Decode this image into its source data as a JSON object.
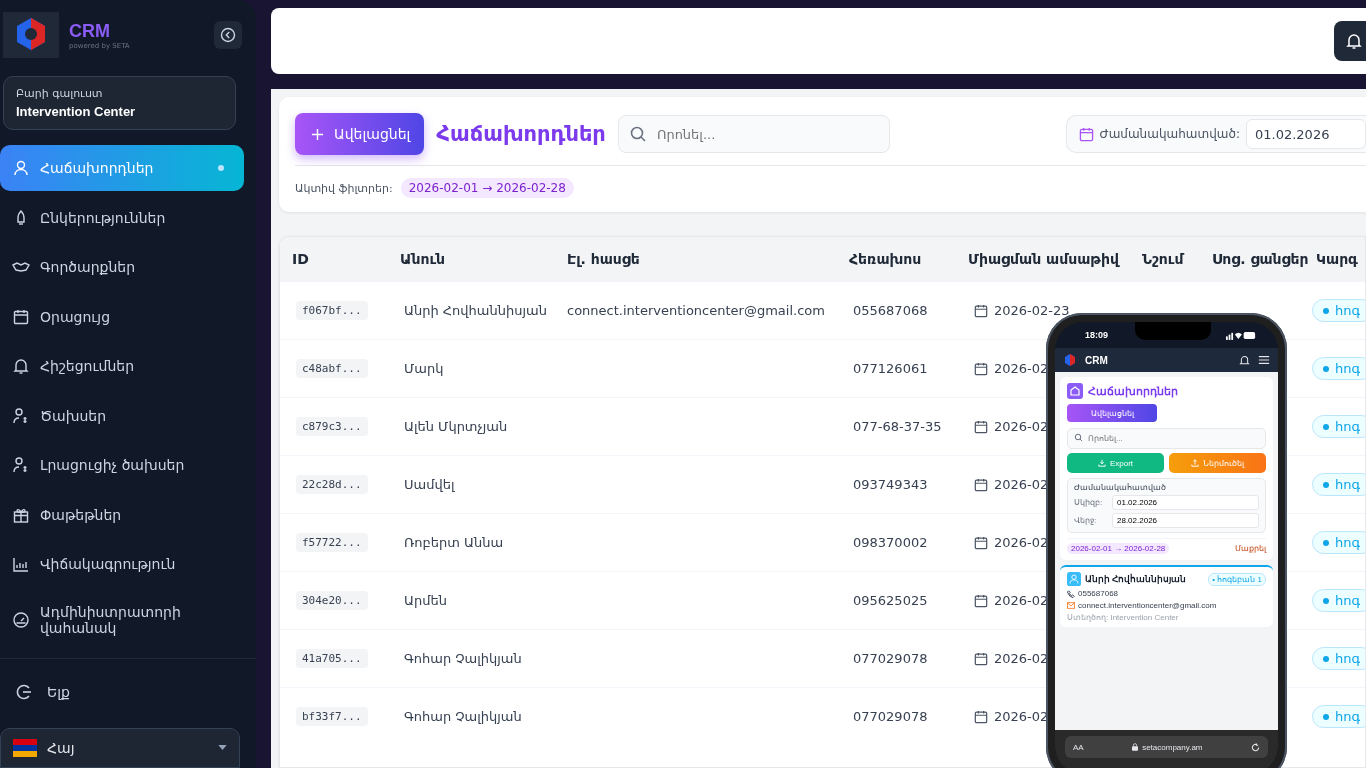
{
  "sidebar": {
    "brand": "CRM",
    "tagline": "powered by SETA",
    "welcome": {
      "greeting": "Բարի գալուստ",
      "name": "Intervention Center"
    },
    "items": [
      {
        "label": "Հաճախորդներ",
        "selected": true
      },
      {
        "label": "Ընկերություններ",
        "selected": false
      },
      {
        "label": "Գործարքներ",
        "selected": false
      },
      {
        "label": "Օրացույց",
        "selected": false
      },
      {
        "label": "Հիշեցումներ",
        "selected": false
      },
      {
        "label": "Ծախսեր",
        "selected": false
      },
      {
        "label": "Լրացուցիչ ծախսեր",
        "selected": false
      },
      {
        "label": "Փաթեթներ",
        "selected": false
      },
      {
        "label": "Վիճակագրություն",
        "selected": false
      },
      {
        "label": "Ադմինիստրատորի վահանակ",
        "selected": false
      }
    ],
    "logout": "Ելք",
    "language": "Հայ"
  },
  "toolbar": {
    "add_button": "Ավելացնել",
    "title": "Հաճախորդներ",
    "search": {
      "placeholder": "Որոնել..."
    },
    "period_label": "Ժամանակահատված:",
    "date_from": "01.02.2026",
    "filters_label": "Ակտիվ ֆիլտրեր:",
    "filter_chip": "2026-02-01 → 2026-02-28"
  },
  "table": {
    "columns": [
      "ID",
      "Անուն",
      "Էլ. հասցե",
      "Հեռախոս",
      "Միացման ամսաթիվ",
      "Նշում",
      "Սոց. ցանցեր",
      "Կարգ"
    ],
    "rows": [
      {
        "id": "f067bf...",
        "name": "Անրի Հովհաննիսյան",
        "email": "connect.interventioncenter@gmail.com",
        "phone": "055687068",
        "date": "2026-02-23",
        "status": "հոգ"
      },
      {
        "id": "c48abf...",
        "name": "Մարկ",
        "phone": "077126061",
        "date": "2026-02",
        "status": "հոգ"
      },
      {
        "id": "c879c3...",
        "name": "Ալեն Մկրտչյան",
        "phone": "077-68-37-35",
        "date": "2026-02",
        "status": "հոգ"
      },
      {
        "id": "22c28d...",
        "name": "Սամվել",
        "phone": "093749343",
        "date": "2026-02",
        "status": "հոգ"
      },
      {
        "id": "f57722...",
        "name": "Ռոբերտ Աննա",
        "phone": "098370002",
        "date": "2026-02",
        "status": "հոգ"
      },
      {
        "id": "304e20...",
        "name": "Արմեն",
        "phone": "095625025",
        "date": "2026-02",
        "status": "հոգ"
      },
      {
        "id": "41a705...",
        "name": "Գոհար Չալիկյան",
        "phone": "077029078",
        "date": "2026-02",
        "status": "հոգ"
      },
      {
        "id": "bf33f7...",
        "name": "Գոհար Չալիկյան",
        "phone": "077029078",
        "date": "2026-02",
        "status": "հոգ"
      }
    ]
  },
  "phone": {
    "time": "18:09",
    "app": "CRM",
    "title": "Հաճախորդներ",
    "add_button": "Ավելացնել",
    "search": {
      "placeholder": "Որոնել..."
    },
    "export_button": "Export",
    "import_button": "Ներմուծել",
    "period": "Ժամանակահատված",
    "from_label": "Սկիզբ:",
    "from": "01.02.2026",
    "to_label": "Վերջ:",
    "to": "28.02.2026",
    "chip": "2026-02-01 → 2026-02-28",
    "clear": "Մաքրել",
    "card": {
      "name": "Անրի Հովհաննիսյան",
      "badge": "• հոգեբան 1",
      "phone": "055687068",
      "email": "connect.interventioncenter@gmail.com",
      "creator": "Ստեղծող: Intervention Center"
    },
    "browser": {
      "aa": "AA",
      "url": "setacompany.am"
    }
  }
}
